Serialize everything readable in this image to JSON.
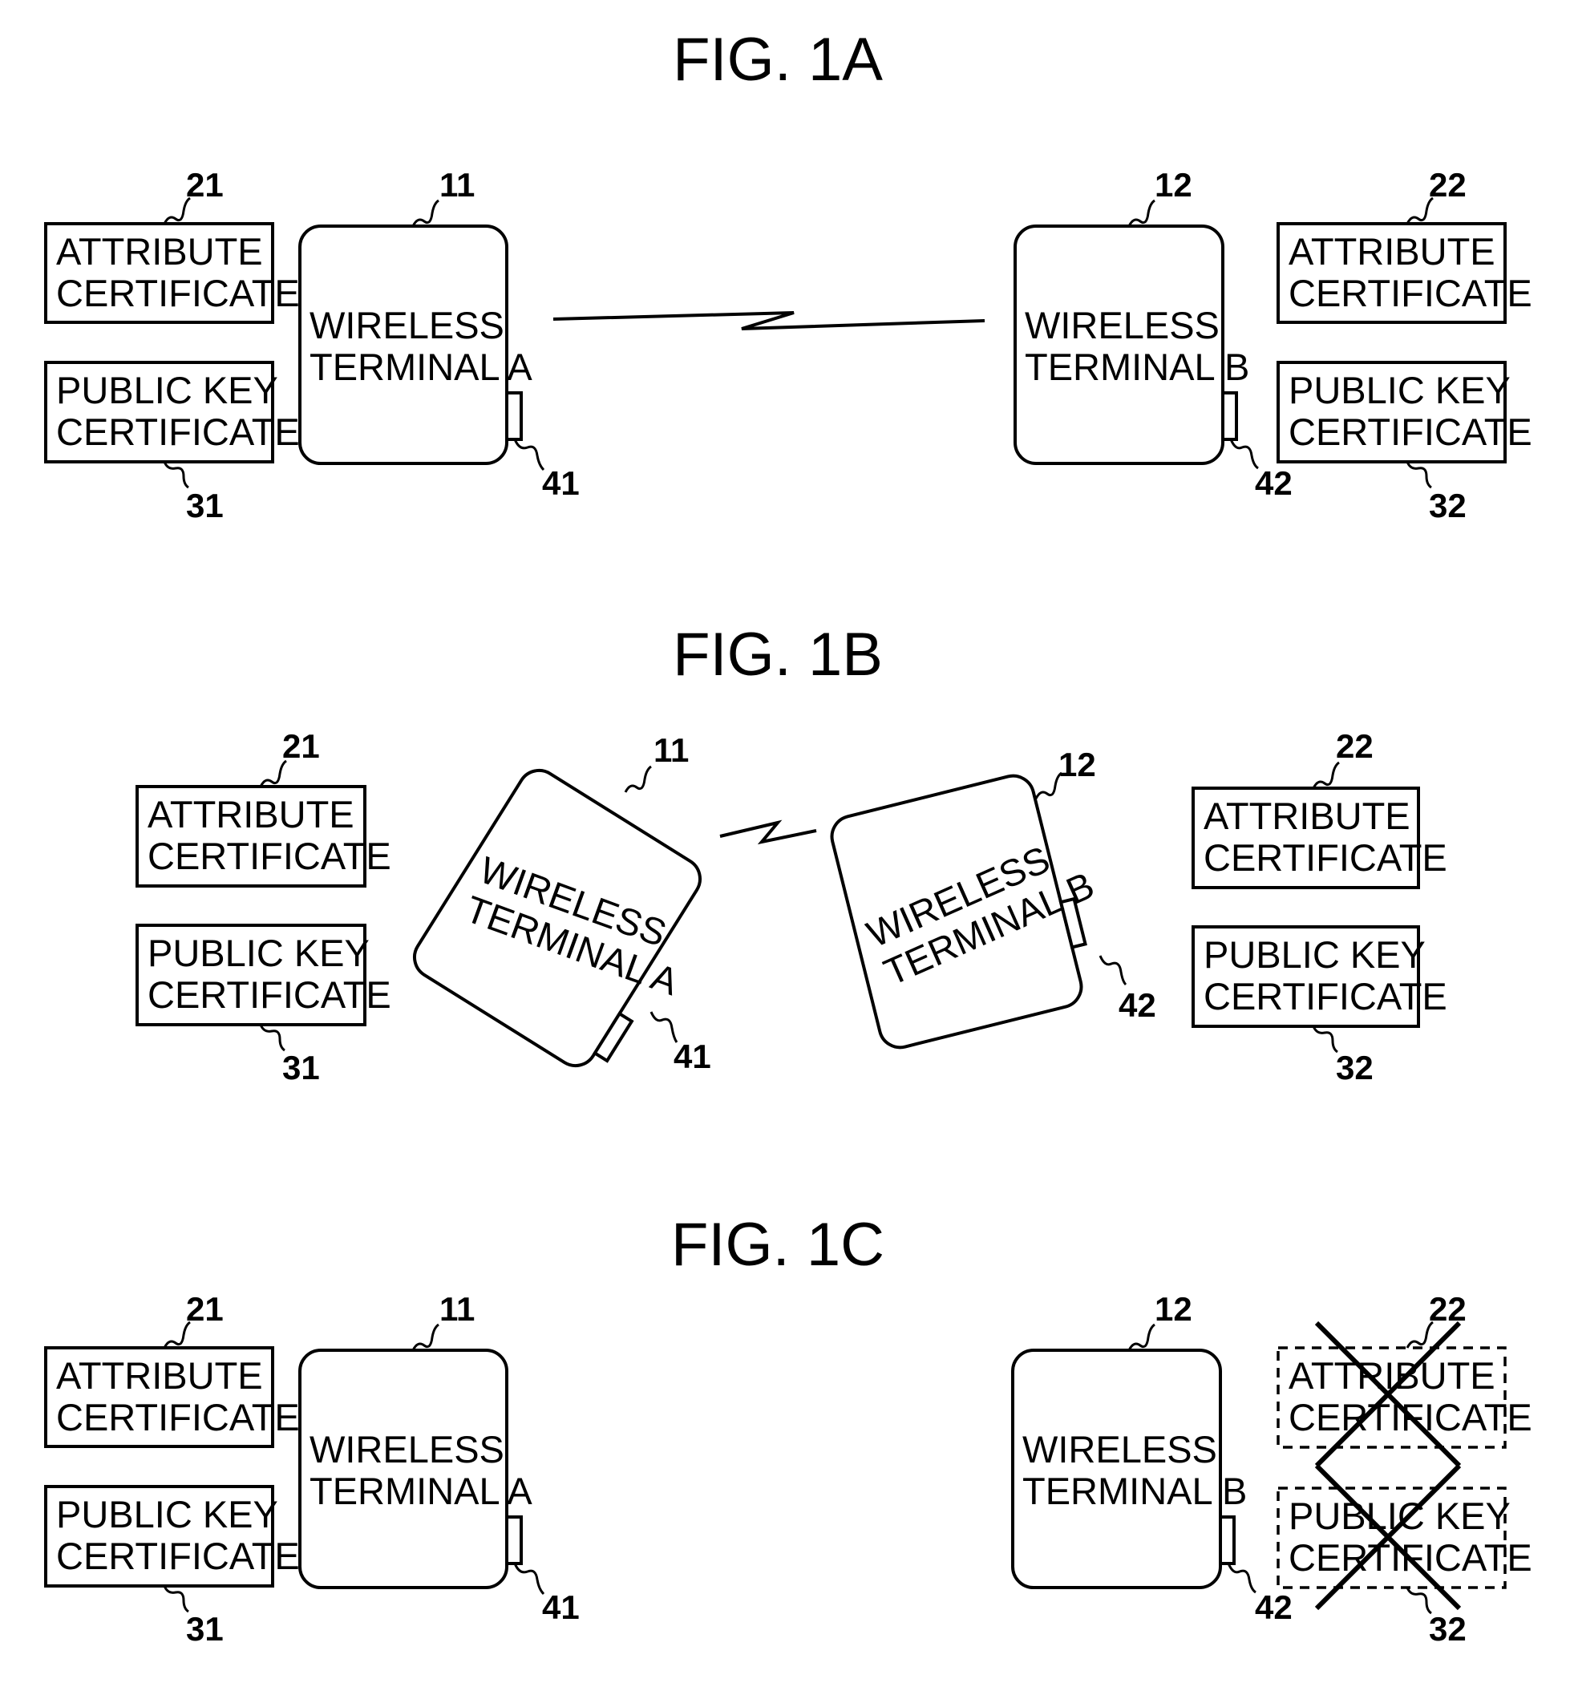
{
  "figures": [
    {
      "title": "FIG. 1A",
      "left_certs": {
        "attribute": [
          "ATTRIBUTE",
          "CERTIFICATE"
        ],
        "attribute_ref": "21",
        "public_key": [
          "PUBLIC KEY",
          "CERTIFICATE"
        ],
        "public_key_ref": "31"
      },
      "terminal_a": {
        "label": [
          "WIRELESS",
          "TERMINAL A"
        ],
        "ref": "11",
        "port_ref": "41"
      },
      "terminal_b": {
        "label": [
          "WIRELESS",
          "TERMINAL B"
        ],
        "ref": "12",
        "port_ref": "42"
      },
      "right_certs": {
        "attribute": [
          "ATTRIBUTE",
          "CERTIFICATE"
        ],
        "attribute_ref": "22",
        "public_key": [
          "PUBLIC KEY",
          "CERTIFICATE"
        ],
        "public_key_ref": "32"
      },
      "wireless_link": true
    },
    {
      "title": "FIG. 1B",
      "left_certs": {
        "attribute": [
          "ATTRIBUTE",
          "CERTIFICATE"
        ],
        "attribute_ref": "21",
        "public_key": [
          "PUBLIC KEY",
          "CERTIFICATE"
        ],
        "public_key_ref": "31"
      },
      "terminal_a": {
        "label": [
          "WIRELESS",
          "TERMINAL A"
        ],
        "ref": "11",
        "port_ref": "41"
      },
      "terminal_b": {
        "label": [
          "WIRELESS",
          "TERMINAL B"
        ],
        "ref": "12",
        "port_ref": "42"
      },
      "right_certs": {
        "attribute": [
          "ATTRIBUTE",
          "CERTIFICATE"
        ],
        "attribute_ref": "22",
        "public_key": [
          "PUBLIC KEY",
          "CERTIFICATE"
        ],
        "public_key_ref": "32"
      },
      "wireless_link": true
    },
    {
      "title": "FIG. 1C",
      "left_certs": {
        "attribute": [
          "ATTRIBUTE",
          "CERTIFICATE"
        ],
        "attribute_ref": "21",
        "public_key": [
          "PUBLIC KEY",
          "CERTIFICATE"
        ],
        "public_key_ref": "31"
      },
      "terminal_a": {
        "label": [
          "WIRELESS",
          "TERMINAL A"
        ],
        "ref": "11",
        "port_ref": "41"
      },
      "terminal_b": {
        "label": [
          "WIRELESS",
          "TERMINAL B"
        ],
        "ref": "12",
        "port_ref": "42"
      },
      "right_certs": {
        "attribute": [
          "ATTRIBUTE",
          "CERTIFICATE"
        ],
        "attribute_ref": "22",
        "public_key": [
          "PUBLIC KEY",
          "CERTIFICATE"
        ],
        "public_key_ref": "32",
        "deleted": true
      },
      "wireless_link": false
    }
  ]
}
